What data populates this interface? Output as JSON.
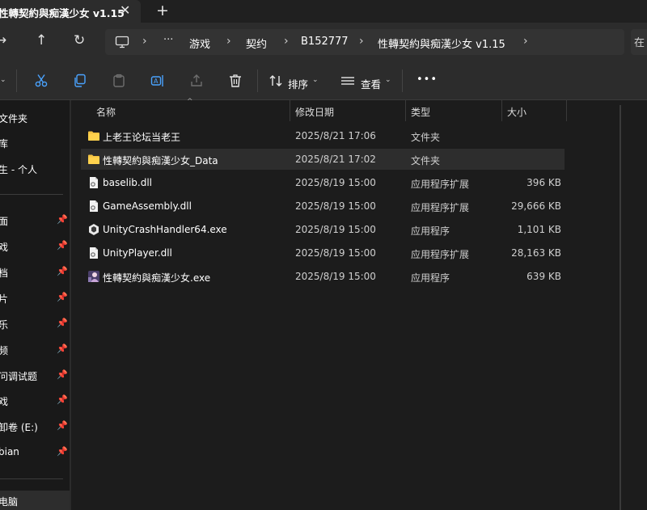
{
  "window": {
    "tab_title": "性轉契約與痴漢少女 v1.15",
    "close_glyph": "✕",
    "new_tab_glyph": "+"
  },
  "nav": {
    "back_glyph": "→",
    "up_glyph": "↑",
    "refresh_glyph": "↻",
    "breadcrumbs": [
      "游戏",
      "契约",
      "B152777",
      "性轉契約與痴漢少女 v1.15"
    ],
    "more_glyph": "···",
    "search_glyph": "在"
  },
  "toolbar": {
    "sort_label": "排序",
    "view_label": "查看",
    "more_glyph": "•••"
  },
  "sidebar": {
    "items": [
      {
        "label": "文件夹",
        "pinned": false
      },
      {
        "label": "库",
        "pinned": false
      },
      {
        "label": "生 - 个人",
        "pinned": false
      },
      {
        "label": "面",
        "pinned": true
      },
      {
        "label": "戏",
        "pinned": true
      },
      {
        "label": "档",
        "pinned": true
      },
      {
        "label": "片",
        "pinned": true
      },
      {
        "label": "乐",
        "pinned": true
      },
      {
        "label": "频",
        "pinned": true
      },
      {
        "label": "问调试题",
        "pinned": true
      },
      {
        "label": "戏",
        "pinned": true
      },
      {
        "label": "卸卷 (E:)",
        "pinned": true
      },
      {
        "label": "bian",
        "pinned": true
      },
      {
        "label": "电脑",
        "pinned": false
      }
    ],
    "pin_glyph": "📌"
  },
  "list": {
    "columns": {
      "name": "名称",
      "modified": "修改日期",
      "type": "类型",
      "size": "大小"
    },
    "rows": [
      {
        "icon": "folder-icon",
        "name": "上老王论坛当老王",
        "modified": "2025/8/21 17:06",
        "type": "文件夹",
        "size": ""
      },
      {
        "icon": "folder-icon",
        "name": "性轉契約與痴漢少女_Data",
        "modified": "2025/8/21 17:02",
        "type": "文件夹",
        "size": "",
        "selected": true
      },
      {
        "icon": "dll-file-icon",
        "name": "baselib.dll",
        "modified": "2025/8/19 15:00",
        "type": "应用程序扩展",
        "size": "396 KB"
      },
      {
        "icon": "dll-file-icon",
        "name": "GameAssembly.dll",
        "modified": "2025/8/19 15:00",
        "type": "应用程序扩展",
        "size": "29,666 KB"
      },
      {
        "icon": "unity-exe-icon",
        "name": "UnityCrashHandler64.exe",
        "modified": "2025/8/19 15:00",
        "type": "应用程序",
        "size": "1,101 KB"
      },
      {
        "icon": "dll-file-icon",
        "name": "UnityPlayer.dll",
        "modified": "2025/8/19 15:00",
        "type": "应用程序扩展",
        "size": "28,163 KB"
      },
      {
        "icon": "game-exe-icon",
        "name": "性轉契約與痴漢少女.exe",
        "modified": "2025/8/19 15:00",
        "type": "应用程序",
        "size": "639 KB"
      }
    ]
  },
  "colors": {
    "accent": "#4aa3ff",
    "folder": "#f3c343",
    "background": "#1c1c1c",
    "selected_row": "#2d2d2d"
  }
}
